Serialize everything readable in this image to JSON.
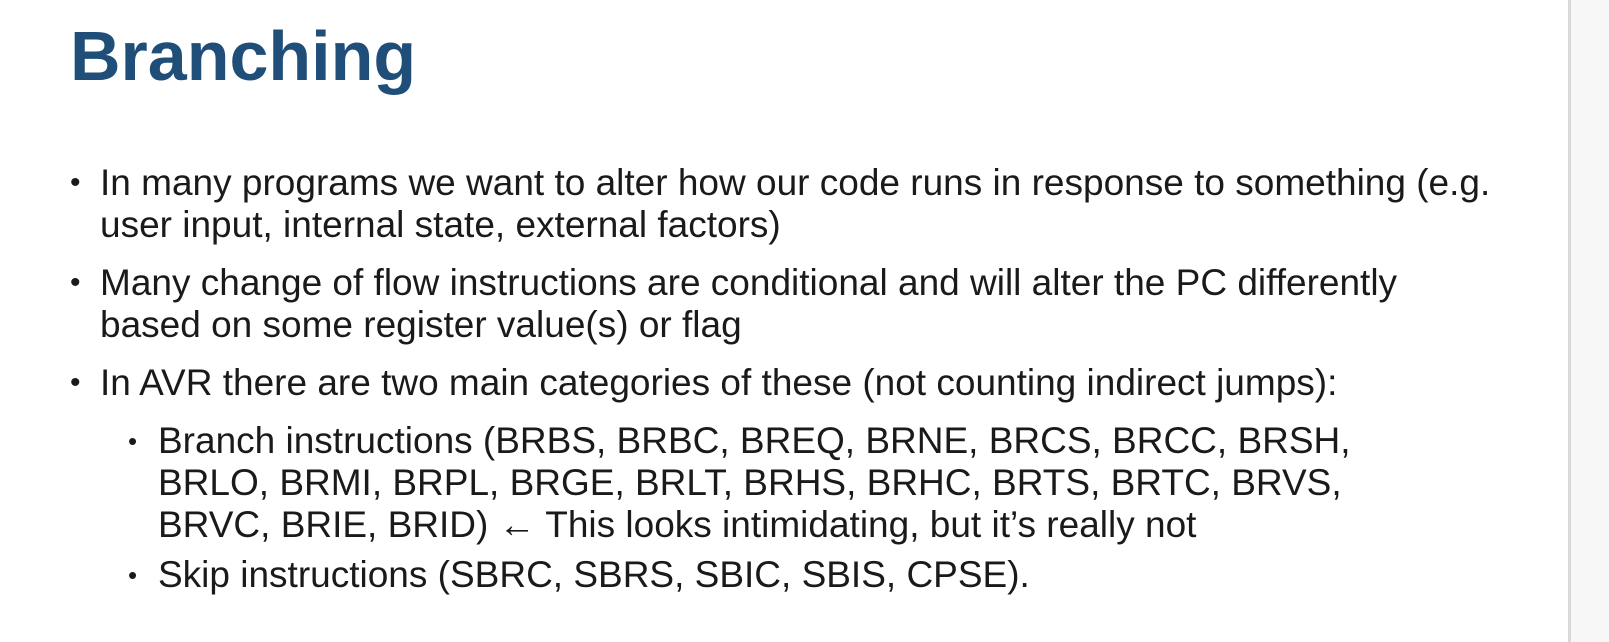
{
  "title": "Branching",
  "bullets": [
    {
      "text": "In many programs we want to alter how our code runs in response to something (e.g. user input, internal state, external factors)"
    },
    {
      "text": "Many change of flow instructions are conditional and will alter the PC differently based on some register value(s) or flag"
    },
    {
      "text": "In AVR there are two main categories of these (not counting indirect jumps):",
      "subitems": [
        {
          "text": "Branch instructions (BRBS, BRBC, BREQ, BRNE, BRCS, BRCC, BRSH, BRLO, BRMI, BRPL, BRGE, BRLT, BRHS, BRHC, BRTS, BRTC, BRVS, BRVC, BRIE, BRID) ← This looks intimidating, but it’s really not"
        },
        {
          "text": "Skip instructions (SBRC, SBRS, SBIC, SBIS, CPSE)."
        }
      ]
    }
  ],
  "bullet_glyph": "•",
  "colors": {
    "title": "#1f4e79",
    "text": "#1a1a1a",
    "background": "#ffffff"
  }
}
